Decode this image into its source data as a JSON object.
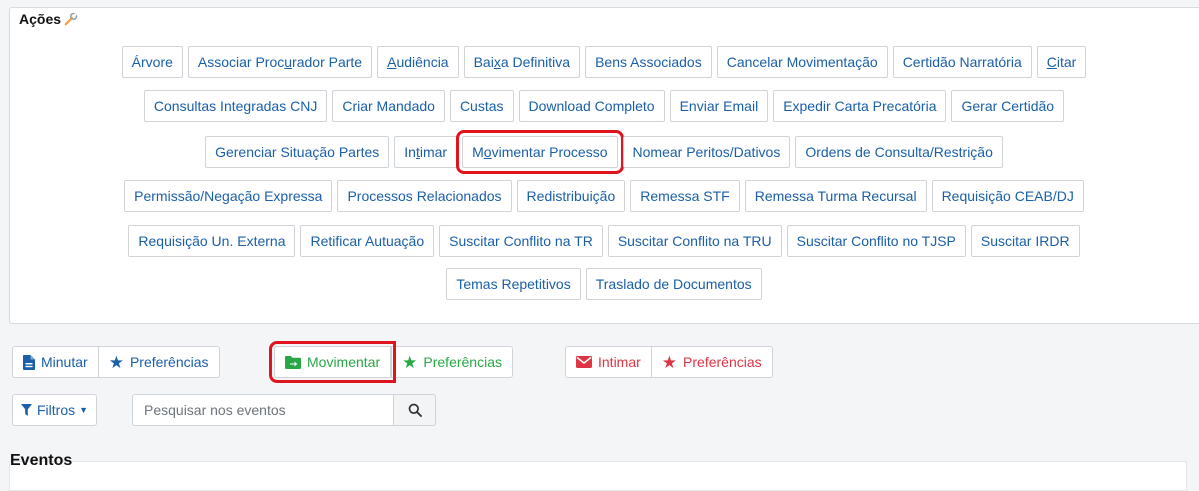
{
  "acoes": {
    "title": "Ações",
    "rows": [
      [
        {
          "pre": "Árvore",
          "u": "",
          "post": ""
        },
        {
          "pre": "Associar Proc",
          "u": "u",
          "post": "rador Parte"
        },
        {
          "pre": "",
          "u": "A",
          "post": "udiência"
        },
        {
          "pre": "Bai",
          "u": "x",
          "post": "a Definitiva"
        },
        {
          "pre": "Bens Associados",
          "u": "",
          "post": ""
        },
        {
          "pre": "Cancelar Movimentação",
          "u": "",
          "post": ""
        },
        {
          "pre": "Certidão Narratória",
          "u": "",
          "post": ""
        },
        {
          "pre": "",
          "u": "C",
          "post": "itar"
        }
      ],
      [
        {
          "pre": "Consultas Integradas CNJ",
          "u": "",
          "post": ""
        },
        {
          "pre": "Criar Mandado",
          "u": "",
          "post": ""
        },
        {
          "pre": "Custas",
          "u": "",
          "post": ""
        },
        {
          "pre": "Download Completo",
          "u": "",
          "post": ""
        },
        {
          "pre": "Enviar Email",
          "u": "",
          "post": ""
        },
        {
          "pre": "Expedir Carta Precatória",
          "u": "",
          "post": ""
        },
        {
          "pre": "Gerar Certidão",
          "u": "",
          "post": ""
        }
      ],
      [
        {
          "pre": "Gerenciar Situação Partes",
          "u": "",
          "post": ""
        },
        {
          "pre": "In",
          "u": "t",
          "post": "imar"
        },
        {
          "pre": "M",
          "u": "o",
          "post": "vimentar Processo",
          "highlight": true
        },
        {
          "pre": "Nomear Peritos/Dativos",
          "u": "",
          "post": ""
        },
        {
          "pre": "Ordens de Consulta/Restrição",
          "u": "",
          "post": ""
        }
      ],
      [
        {
          "pre": "Permissão/Negação Expressa",
          "u": "",
          "post": ""
        },
        {
          "pre": "Processos Relacionados",
          "u": "",
          "post": ""
        },
        {
          "pre": "Redistribuição",
          "u": "",
          "post": ""
        },
        {
          "pre": "Remessa STF",
          "u": "",
          "post": ""
        },
        {
          "pre": "Remessa Turma Recursal",
          "u": "",
          "post": ""
        },
        {
          "pre": "Requisição CEAB/DJ",
          "u": "",
          "post": ""
        }
      ],
      [
        {
          "pre": "Requisição Un. Externa",
          "u": "",
          "post": ""
        },
        {
          "pre": "Retificar Autuação",
          "u": "",
          "post": ""
        },
        {
          "pre": "Suscitar Conflito na TR",
          "u": "",
          "post": ""
        },
        {
          "pre": "Suscitar Conflito na TRU",
          "u": "",
          "post": ""
        },
        {
          "pre": "Suscitar Conflito no TJSP",
          "u": "",
          "post": ""
        },
        {
          "pre": "Suscitar IRDR",
          "u": "",
          "post": ""
        }
      ],
      [
        {
          "pre": "Temas Repetitivos",
          "u": "",
          "post": ""
        },
        {
          "pre": "Traslado de Documentos",
          "u": "",
          "post": ""
        }
      ]
    ]
  },
  "toolbar": {
    "minutar": "Minutar",
    "pref1": "Preferências",
    "movimentar": "Movimentar",
    "pref2": "Preferências",
    "intimar": "Intimar",
    "pref3": "Preferências"
  },
  "filters": {
    "label": "Filtros",
    "search_placeholder": "Pesquisar nos eventos"
  },
  "eventos": {
    "title": "Eventos"
  },
  "colors": {
    "link": "#1a5fa8",
    "green": "#28a745",
    "red": "#dc3545",
    "highlight": "#e0141e"
  }
}
